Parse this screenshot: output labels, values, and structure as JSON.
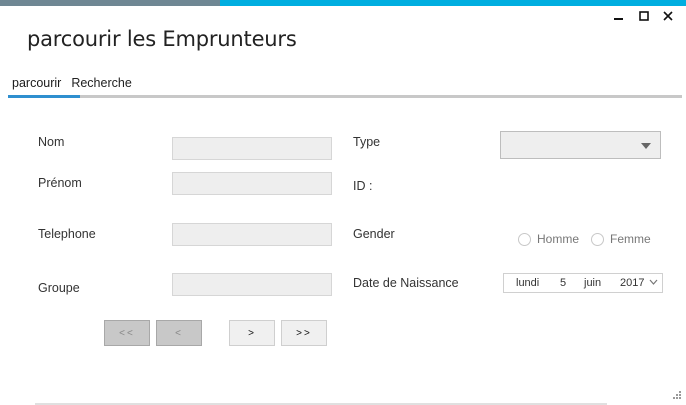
{
  "window": {
    "title": "parcourir les Emprunteurs",
    "accent_color": "#00aee0"
  },
  "controls": {
    "minimize_icon": "minimize-icon",
    "maximize_icon": "maximize-icon",
    "close_icon": "close-icon"
  },
  "tabs": [
    {
      "label": "parcourir",
      "active": true
    },
    {
      "label": "Recherche",
      "active": false
    }
  ],
  "form": {
    "nom_label": "Nom",
    "nom_value": "",
    "prenom_label": "Prénom",
    "prenom_value": "",
    "telephone_label": "Telephone",
    "telephone_value": "",
    "groupe_label": "Groupe",
    "groupe_value": "",
    "type_label": "Type",
    "type_value": "",
    "id_label": "ID :",
    "gender_label": "Gender",
    "gender_options": [
      "Homme",
      "Femme"
    ],
    "date_label": "Date de Naissance",
    "date": {
      "weekday": "lundi",
      "day": "5",
      "month": "juin",
      "year": "2017"
    }
  },
  "navigation": {
    "first_label": "<<",
    "prev_label": "<",
    "next_label": ">",
    "last_label": ">>"
  }
}
